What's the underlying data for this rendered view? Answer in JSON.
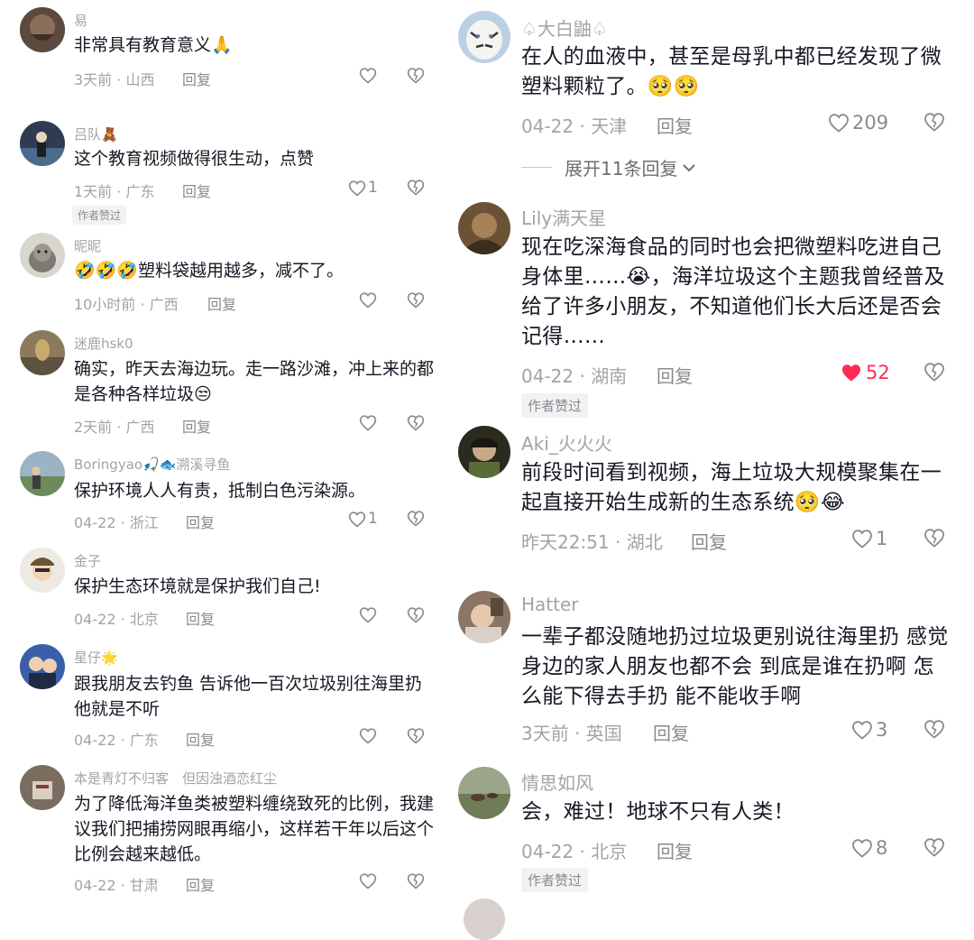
{
  "left_comments": [
    {
      "user": "易",
      "text": "非常具有教育意义🙏",
      "time": "3天前 · 山西",
      "reply": "回复",
      "likes": "",
      "author_liked": ""
    },
    {
      "user": "吕队🧸",
      "text": "这个教育视频做得很生动，点赞",
      "time": "1天前 · 广东",
      "reply": "回复",
      "likes": "1",
      "author_liked": "作者赞过"
    },
    {
      "user": "昵昵",
      "text": "🤣🤣🤣塑料袋越用越多，减不了。",
      "time": "10小时前 · 广西",
      "reply": "回复",
      "likes": "",
      "author_liked": ""
    },
    {
      "user": "迷鹿hsk0",
      "text": "确实，昨天去海边玩。走一路沙滩，冲上来的都是各种各样垃圾😒",
      "time": "2天前 · 广西",
      "reply": "回复",
      "likes": "",
      "author_liked": ""
    },
    {
      "user": "Boringyao🎣🐟溯溪寻鱼",
      "text": "保护环境人人有责，抵制白色污染源。",
      "time": "04-22 · 浙江",
      "reply": "回复",
      "likes": "1",
      "author_liked": ""
    },
    {
      "user": "金子",
      "text": "保护生态环境就是保护我们自己!",
      "time": "04-22 · 北京",
      "reply": "回复",
      "likes": "",
      "author_liked": ""
    },
    {
      "user": "星仔🌟",
      "text": "跟我朋友去钓鱼 告诉他一百次垃圾别往海里扔 他就是不听",
      "time": "04-22 · 广东",
      "reply": "回复",
      "likes": "",
      "author_liked": ""
    },
    {
      "user": "本是青灯不归客　但因浊酒恋红尘",
      "text": "为了降低海洋鱼类被塑料缠绕致死的比例，我建议我们把捕捞网眼再缩小，这样若干年以后这个比例会越来越低。",
      "time": "04-22 · 甘肃",
      "reply": "回复",
      "likes": "",
      "author_liked": ""
    }
  ],
  "right_comments": [
    {
      "user": "♤大白鼬♤",
      "text": "在人的血液中，甚至是母乳中都已经发现了微塑料颗粒了。🥺🥺",
      "time": "04-22 · 天津",
      "reply": "回复",
      "likes": "209",
      "liked": false,
      "author_liked": "",
      "expand": "展开11条回复"
    },
    {
      "user": "Lily满天星",
      "text": "现在吃深海食品的同时也会把微塑料吃进自己身体里……😭，海洋垃圾这个主题我曾经普及给了许多小朋友，不知道他们长大后还是否会记得……",
      "time": "04-22 · 湖南",
      "reply": "回复",
      "likes": "52",
      "liked": true,
      "author_liked": "作者赞过",
      "expand": ""
    },
    {
      "user": "Aki_火火火",
      "text": "前段时间看到视频，海上垃圾大规模聚集在一起直接开始生成新的生态系统🥺😂",
      "time": "昨天22:51 · 湖北",
      "reply": "回复",
      "likes": "1",
      "liked": false,
      "author_liked": "",
      "expand": ""
    },
    {
      "user": "Hatter",
      "text": "一辈子都没随地扔过垃圾更别说往海里扔 感觉身边的家人朋友也都不会 到底是谁在扔啊 怎么能下得去手扔 能不能收手啊",
      "time": "3天前 · 英国",
      "reply": "回复",
      "likes": "3",
      "liked": false,
      "author_liked": "",
      "expand": ""
    },
    {
      "user": "情思如风",
      "text": "会，难过！地球不只有人类！",
      "time": "04-22 · 北京",
      "reply": "回复",
      "likes": "8",
      "liked": false,
      "author_liked": "作者赞过",
      "expand": ""
    }
  ],
  "colors": {
    "text": "#161823",
    "muted": "#a3a3a8",
    "liked": "#fe2c55",
    "badge_bg": "#f2f2f4"
  },
  "icons": {
    "like": "heart-icon",
    "dislike": "broken-heart-icon",
    "expand": "chevron-down-icon"
  }
}
